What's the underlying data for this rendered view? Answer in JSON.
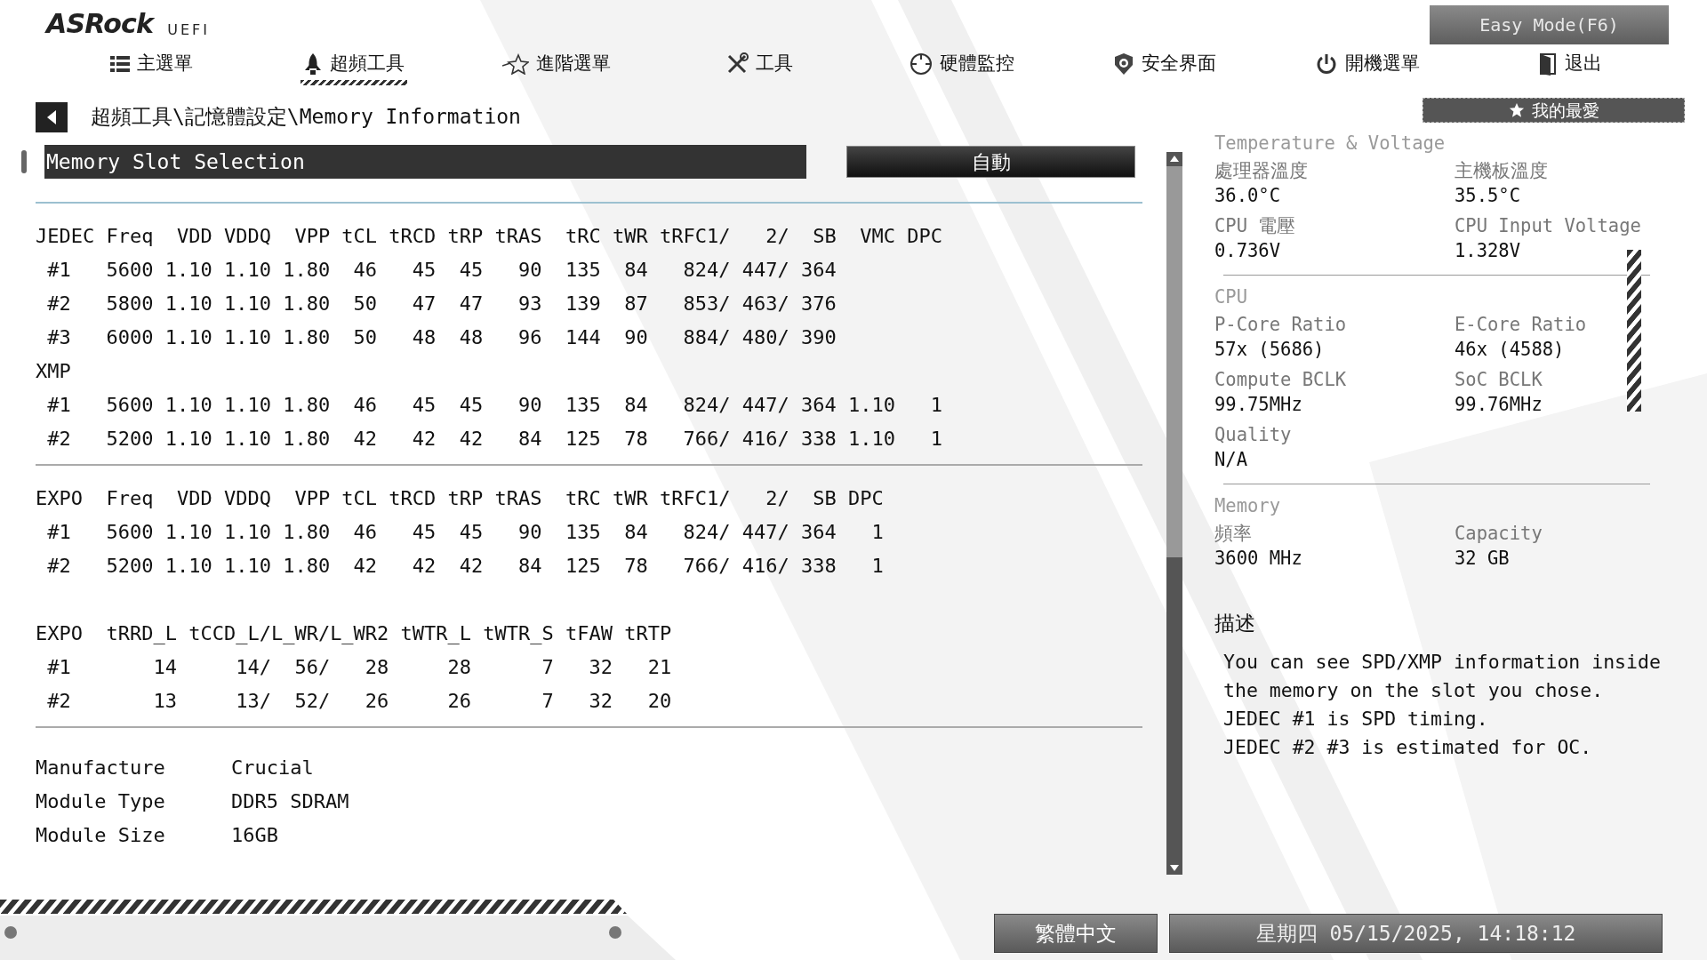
{
  "header": {
    "logo": "ASRock",
    "logo_suffix": "UEFI",
    "mode_button": "Easy Mode(F6)"
  },
  "nav_tabs": [
    {
      "label": "主選單",
      "selected": false
    },
    {
      "label": "超頻工具",
      "selected": true
    },
    {
      "label": "進階選單",
      "selected": false
    },
    {
      "label": "工具",
      "selected": false
    },
    {
      "label": "硬體監控",
      "selected": false
    },
    {
      "label": "安全界面",
      "selected": false
    },
    {
      "label": "開機選單",
      "selected": false
    },
    {
      "label": "退出",
      "selected": false
    }
  ],
  "breadcrumb": "超頻工具\\記憶體設定\\Memory Information",
  "favorites_button": "我的最愛",
  "slot_selection": {
    "label": "Memory Slot Selection",
    "value": "自動",
    "selected": true
  },
  "info_blocks": [
    {
      "divider_after": true,
      "lines": [
        "JEDEC Freq  VDD VDDQ  VPP tCL tRCD tRP tRAS  tRC tWR tRFC1/   2/  SB  VMC DPC",
        " #1   5600 1.10 1.10 1.80  46   45  45   90  135  84   824/ 447/ 364",
        " #2   5800 1.10 1.10 1.80  50   47  47   93  139  87   853/ 463/ 376",
        " #3   6000 1.10 1.10 1.80  50   48  48   96  144  90   884/ 480/ 390",
        "XMP",
        " #1   5600 1.10 1.10 1.80  46   45  45   90  135  84   824/ 447/ 364 1.10   1",
        " #2   5200 1.10 1.10 1.80  42   42  42   84  125  78   766/ 416/ 338 1.10   1"
      ]
    },
    {
      "divider_after": false,
      "lines": [
        "EXPO  Freq  VDD VDDQ  VPP tCL tRCD tRP tRAS  tRC tWR tRFC1/   2/  SB DPC",
        " #1   5600 1.10 1.10 1.80  46   45  45   90  135  84   824/ 447/ 364   1",
        " #2   5200 1.10 1.10 1.80  42   42  42   84  125  78   766/ 416/ 338   1"
      ]
    },
    {
      "divider_after": true,
      "lines": [
        "EXPO  tRRD_L tCCD_L/L_WR/L_WR2 tWTR_L tWTR_S tFAW tRTP",
        " #1       14     14/  56/   28     28      7   32   21",
        " #2       13     13/  52/   26     26      7   32   20"
      ]
    }
  ],
  "module_details": [
    {
      "label": "Manufacture",
      "value": "Crucial"
    },
    {
      "label": "Module Type",
      "value": "DDR5 SDRAM"
    },
    {
      "label": "Module Size",
      "value": "16GB"
    }
  ],
  "monitor": [
    {
      "title": "Temperature & Voltage",
      "items": [
        {
          "label": "處理器溫度",
          "value": "36.0°C"
        },
        {
          "label": "主機板溫度",
          "value": "35.5°C"
        },
        {
          "label": "CPU 電壓",
          "value": "0.736V"
        },
        {
          "label": "CPU Input Voltage",
          "value": "1.328V"
        }
      ]
    },
    {
      "title": "CPU",
      "items": [
        {
          "label": "P-Core Ratio",
          "value": "57x (5686)"
        },
        {
          "label": "E-Core Ratio",
          "value": "46x (4588)"
        },
        {
          "label": "Compute BCLK",
          "value": "99.75MHz"
        },
        {
          "label": "SoC BCLK",
          "value": "99.76MHz"
        },
        {
          "label": "Quality",
          "value": "N/A"
        }
      ]
    },
    {
      "title": "Memory",
      "items": [
        {
          "label": "頻率",
          "value": "3600 MHz"
        },
        {
          "label": "Capacity",
          "value": "32 GB"
        }
      ]
    }
  ],
  "description": {
    "title": "描述",
    "text": "You can see SPD/XMP information inside\nthe memory on the slot you chose.\nJEDEC #1 is SPD timing.\nJEDEC #2 #3 is estimated for OC."
  },
  "footer": {
    "language": "繁體中文",
    "datetime": "星期四 05/15/2025, 14:18:12"
  }
}
